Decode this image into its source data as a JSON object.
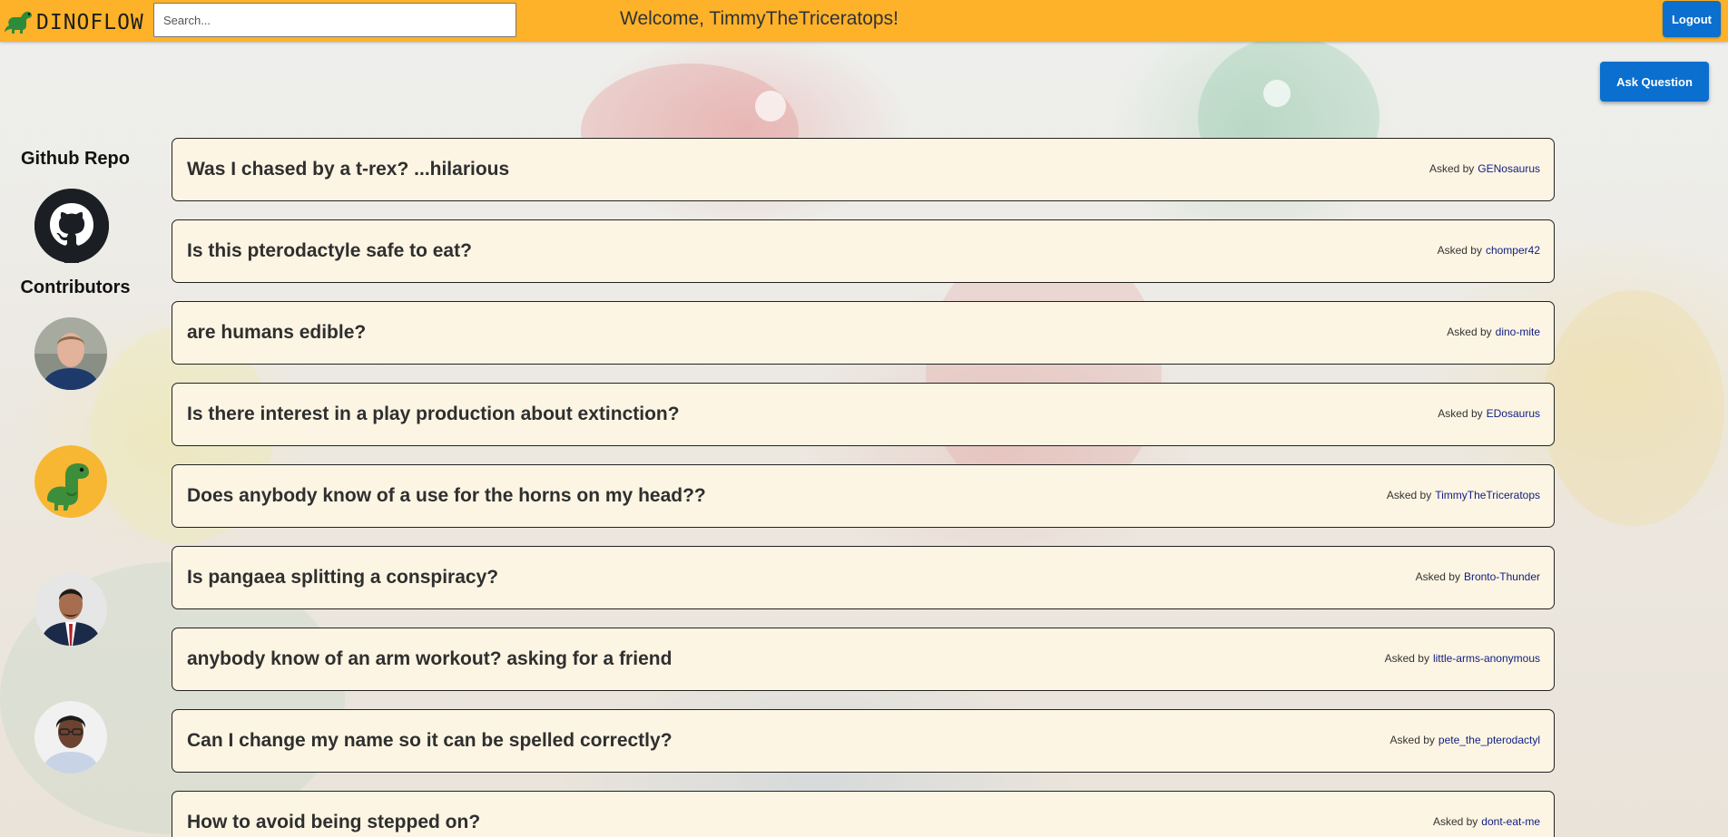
{
  "header": {
    "logo_text": "DINOFLOW",
    "search_placeholder": "Search...",
    "search_value": "",
    "welcome": "Welcome, TimmyTheTriceratops!",
    "logout_label": "Logout"
  },
  "ask_question_label": "Ask Question",
  "sidebar": {
    "github_heading": "Github Repo",
    "contributors_heading": "Contributors"
  },
  "questions": [
    {
      "title": "Was I chased by a t-rex? ...hilarious",
      "asked_by_label": "Asked by",
      "user": "GENosaurus"
    },
    {
      "title": "Is this pterodactyle safe to eat?",
      "asked_by_label": "Asked by",
      "user": "chomper42"
    },
    {
      "title": "are humans edible?",
      "asked_by_label": "Asked by",
      "user": "dino-mite"
    },
    {
      "title": "Is there interest in a play production about extinction?",
      "asked_by_label": "Asked by",
      "user": "EDosaurus"
    },
    {
      "title": "Does anybody know of a use for the horns on my head??",
      "asked_by_label": "Asked by",
      "user": "TimmyTheTriceratops"
    },
    {
      "title": "Is pangaea splitting a conspiracy?",
      "asked_by_label": "Asked by",
      "user": "Bronto-Thunder"
    },
    {
      "title": "anybody know of an arm workout? asking for a friend",
      "asked_by_label": "Asked by",
      "user": "little-arms-anonymous"
    },
    {
      "title": "Can I change my name so it can be spelled correctly?",
      "asked_by_label": "Asked by",
      "user": "pete_the_pterodactyl"
    },
    {
      "title": "How to avoid being stepped on?",
      "asked_by_label": "Asked by",
      "user": "dont-eat-me"
    }
  ],
  "colors": {
    "header_bg": "#fdb22a",
    "button_blue": "#0a6fcf",
    "card_bg": "#fdf5e3",
    "username": "#0f1d82"
  },
  "icons": {
    "logo": "dinosaur-icon",
    "github": "github-icon"
  }
}
